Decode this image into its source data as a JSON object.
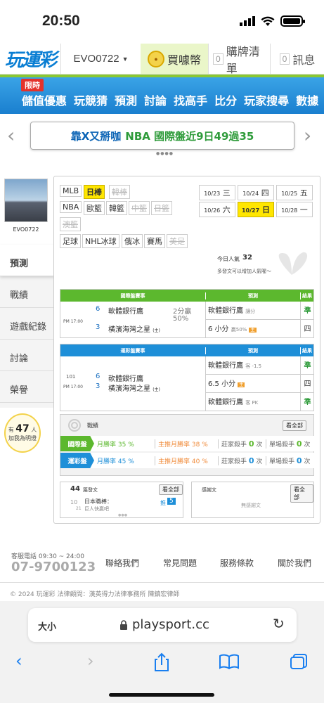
{
  "status": {
    "time": "20:50"
  },
  "header": {
    "logo": "玩運彩",
    "username": "EVO0722",
    "coin_label": "買噱幣",
    "board_count": "0",
    "board_label": "購牌清單",
    "msg_count": "0",
    "msg_label": "訊息"
  },
  "nav": {
    "badge": "限時",
    "items": [
      "儲值優惠",
      "玩競猜",
      "預測",
      "討論",
      "找高手",
      "比分",
      "玩家搜尋",
      "數據"
    ]
  },
  "banner": {
    "text_a": "靠X又掰咖",
    "text_b": "NBA 國際盤近9日49過35"
  },
  "profile": {
    "name": "EVO0722"
  },
  "side": {
    "items": [
      "預測",
      "戰績",
      "遊戲紀錄",
      "討論",
      "榮譽"
    ],
    "fans_pre": "有",
    "fans_count": "47",
    "fans_unit": "人",
    "fans_note": "加我為明燈"
  },
  "sports": {
    "row1": [
      "MLB",
      "日棒",
      "韓棒"
    ],
    "row2": [
      "NBA",
      "歐籃",
      "韓籃",
      "中籃",
      "日籃"
    ],
    "row3": [
      "澳籃"
    ],
    "row4": [
      "足球",
      "NHL冰球",
      "俄冰",
      "賽馬",
      "美足"
    ]
  },
  "dates": [
    {
      "d": "10/23",
      "w": "三"
    },
    {
      "d": "10/24",
      "w": "四"
    },
    {
      "d": "10/25",
      "w": "五"
    },
    {
      "d": "10/26",
      "w": "六"
    },
    {
      "d": "10/27",
      "w": "日"
    },
    {
      "d": "10/28",
      "w": "一"
    }
  ],
  "popularity": {
    "label": "今日人氣",
    "count": "32",
    "hint": "多發文可以增加人氣喔～"
  },
  "intl": {
    "h_game": "國際盤賽事",
    "h_pred": "預測",
    "h_res": "結果",
    "time": "PM 17:00",
    "home_no": "6",
    "home": "軟體銀行鷹",
    "away_no": "3",
    "away": "橫濱海灣之星",
    "away_tag": "(主)",
    "line": "2分贏",
    "pct": "50%",
    "pred1": "軟體銀行鷹",
    "pred1_sub": "讓分",
    "res1": "準",
    "pred2": "6 小分",
    "pred2_sub": "贏50%",
    "res2": "四"
  },
  "lottery": {
    "h_game": "運彩盤賽事",
    "h_pred": "預測",
    "h_res": "結果",
    "game_no": "101",
    "time": "PM 17:00",
    "home_no": "6",
    "home": "軟體銀行鷹",
    "away_no": "3",
    "away": "橫濱海灣之星",
    "away_tag": "(主)",
    "pred1": "軟體銀行鷹",
    "pred1_sub": "客 -1.5",
    "res1": "準",
    "pred2": "6.5 小分",
    "res2": "四",
    "pred3": "軟體銀行鷹",
    "pred3_sub": "客 PK",
    "res3": "準"
  },
  "record": {
    "title": "戰績",
    "all": "看全部",
    "rows": [
      {
        "tag": "國際盤",
        "month": "月勝率",
        "month_v": "35 %",
        "main": "主推月勝率",
        "main_v": "38 %",
        "killer": "莊家殺手",
        "killer_v": "0",
        "unit": "次",
        "single": "單場殺手",
        "single_v": "0",
        "unit2": "次"
      },
      {
        "tag": "運彩盤",
        "month": "月勝率",
        "month_v": "45 %",
        "main": "主推月勝率",
        "main_v": "40 %",
        "killer": "莊家殺手",
        "killer_v": "0",
        "unit": "次",
        "single": "單場殺手",
        "single_v": "0",
        "unit2": "次"
      }
    ]
  },
  "posts": {
    "count": "44",
    "label": "篇發文",
    "all": "看全部",
    "month": "10",
    "day": "21",
    "title": "日本職棒：",
    "sub": "巨人快贏吧",
    "tag": "推",
    "num": "5"
  },
  "reviews": {
    "label": "感謝文",
    "all": "看全部",
    "empty": "無感謝文"
  },
  "footer": {
    "phone_label": "客服電話 09:30 ~ 24:00",
    "phone": "07-9700123",
    "links": [
      "聯絡我們",
      "常見問題",
      "服務條款",
      "關於我們"
    ],
    "copy": "© 2024 玩運彩 法律顧問：漢英得力法律事務所 陳鎮宏律師"
  },
  "browser": {
    "aa": "大小",
    "url": "playsport.cc"
  }
}
